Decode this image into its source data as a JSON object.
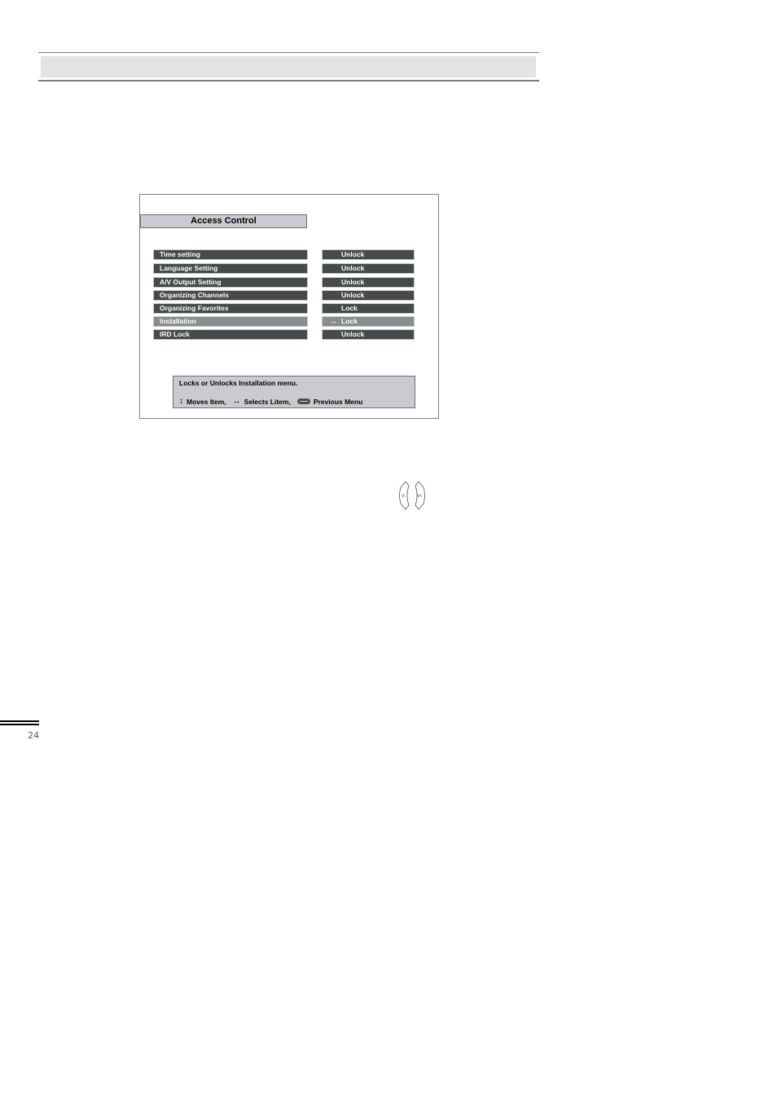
{
  "page": {
    "page_number": "24"
  },
  "osd": {
    "title": "Access Control",
    "items": [
      {
        "label": "Time setting",
        "value": "Unlock",
        "selected": false
      },
      {
        "label": "Language Setting",
        "value": "Unlock",
        "selected": false
      },
      {
        "label": "A/V Output Setting",
        "value": "Unlock",
        "selected": false
      },
      {
        "label": "Organizing Channels",
        "value": "Unlock",
        "selected": false
      },
      {
        "label": "Organizing Favorites",
        "value": "Lock",
        "selected": false
      },
      {
        "label": "Installation",
        "value": "Lock",
        "selected": true
      },
      {
        "label": "IRD Lock",
        "value": "Unlock",
        "selected": false
      }
    ],
    "selected_arrow": "↔",
    "help": {
      "description": "Locks or Unlocks Installation menu.",
      "move_icon": "↕",
      "move_label": "Moves Item,",
      "select_icon": "↔",
      "select_label": "Selects Litem,",
      "menu_icon": "menu-button-icon",
      "previous_label": "Previous Menu"
    }
  },
  "volume_buttons": {
    "left_label": "V-",
    "right_label": "V+"
  },
  "colors": {
    "item_bg": "#464a4b",
    "item_selected_bg": "#8a8d90",
    "panel_bg": "#c9cbd1",
    "header_band": "#e3e3e3"
  }
}
